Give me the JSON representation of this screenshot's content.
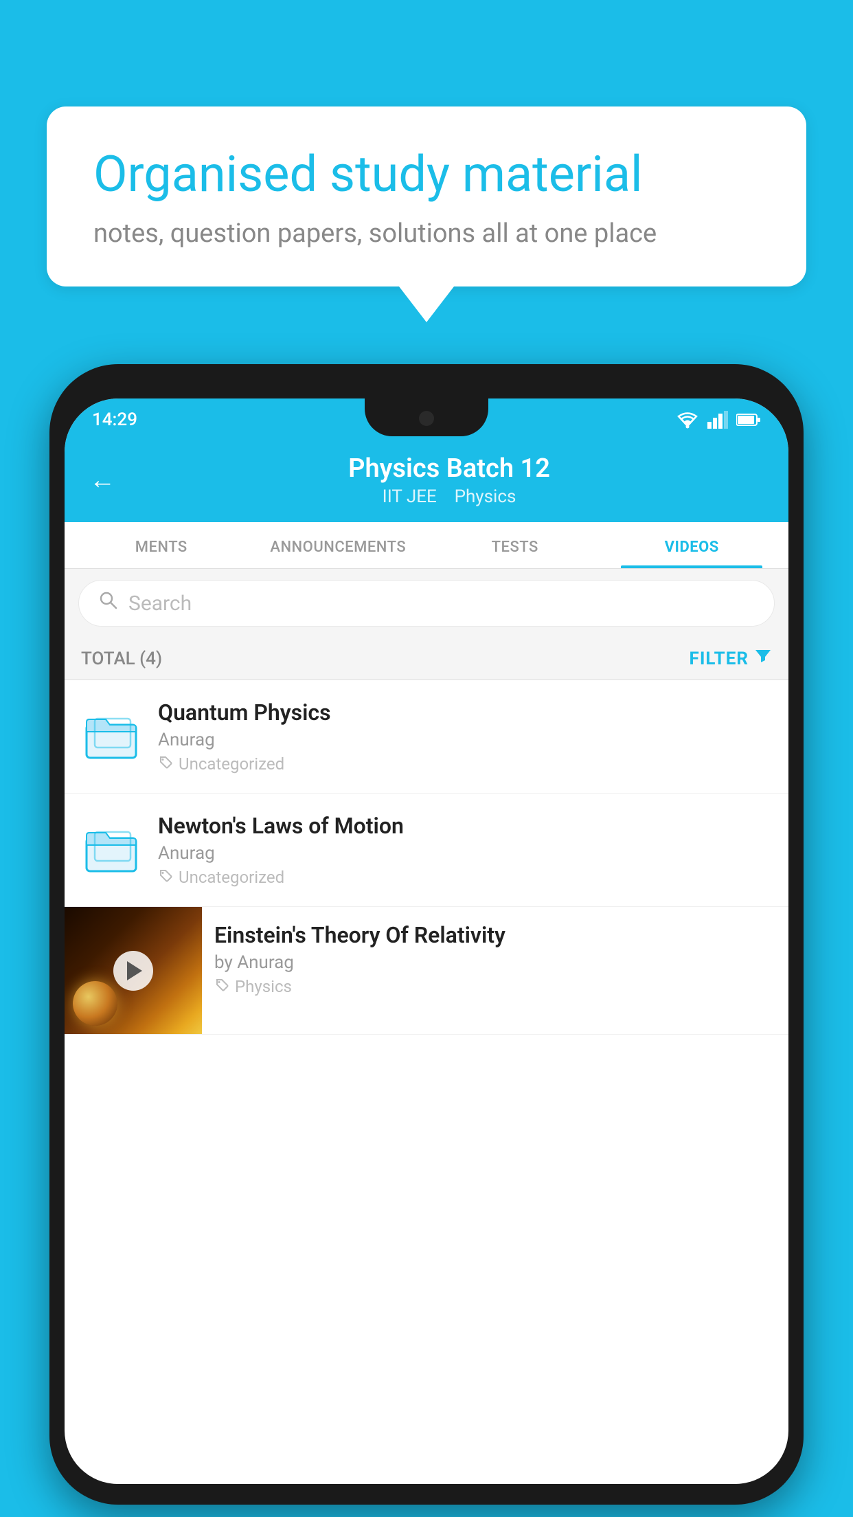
{
  "background_color": "#1bbde8",
  "speech_bubble": {
    "title": "Organised study material",
    "subtitle": "notes, question papers, solutions all at one place"
  },
  "status_bar": {
    "time": "14:29",
    "wifi": "▾",
    "signal": "▾",
    "battery": "▪"
  },
  "header": {
    "title": "Physics Batch 12",
    "subtitle_part1": "IIT JEE",
    "subtitle_part2": "Physics",
    "back_label": "←"
  },
  "tabs": [
    {
      "label": "MENTS",
      "active": false
    },
    {
      "label": "ANNOUNCEMENTS",
      "active": false
    },
    {
      "label": "TESTS",
      "active": false
    },
    {
      "label": "VIDEOS",
      "active": true
    }
  ],
  "search": {
    "placeholder": "Search"
  },
  "filter_row": {
    "total_label": "TOTAL (4)",
    "filter_label": "FILTER"
  },
  "video_items": [
    {
      "id": 1,
      "title": "Quantum Physics",
      "author": "Anurag",
      "tag": "Uncategorized",
      "has_thumbnail": false
    },
    {
      "id": 2,
      "title": "Newton's Laws of Motion",
      "author": "Anurag",
      "tag": "Uncategorized",
      "has_thumbnail": false
    },
    {
      "id": 3,
      "title": "Einstein's Theory Of Relativity",
      "author": "by Anurag",
      "tag": "Physics",
      "has_thumbnail": true
    }
  ]
}
